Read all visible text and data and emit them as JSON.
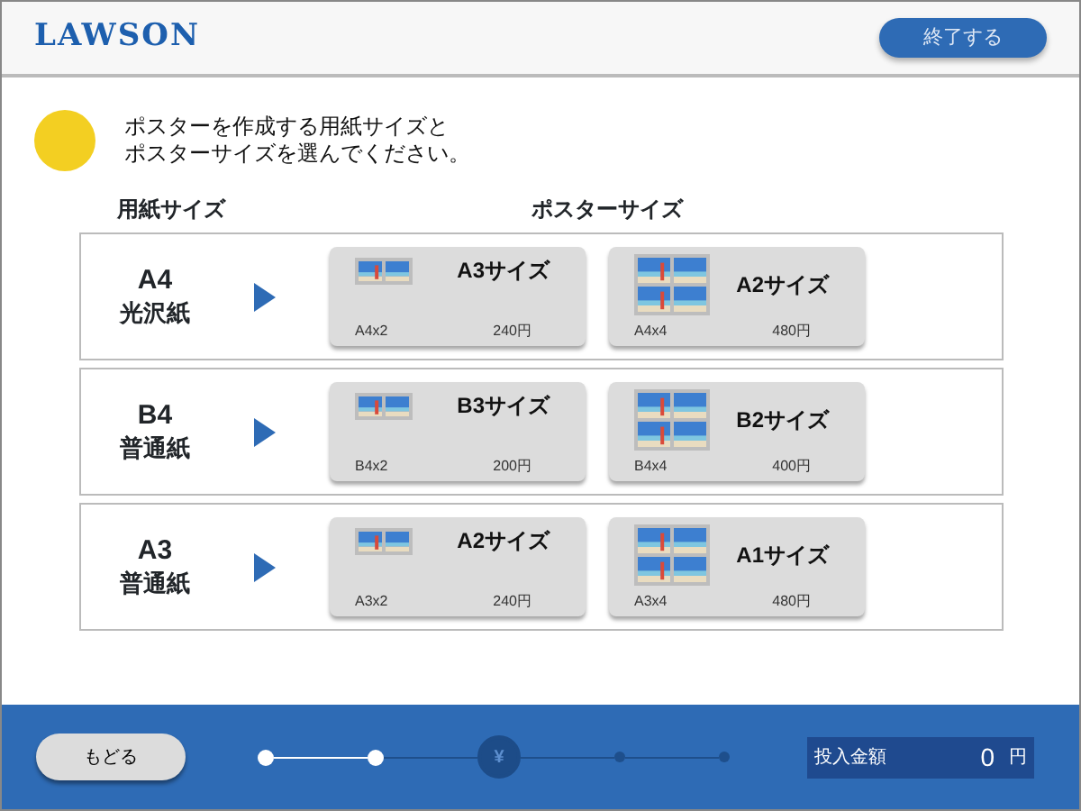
{
  "header": {
    "logo": "LAWSON",
    "exit_button": "終了する"
  },
  "instruction": {
    "lines": [
      "ポスターを作成する用紙サイズと",
      "ポスターサイズを選んでください。"
    ]
  },
  "columns": {
    "paper_size": "用紙サイズ",
    "poster_size": "ポスターサイズ"
  },
  "rows": [
    {
      "size": "A4",
      "paper": "光沢紙",
      "options": [
        {
          "title": "A3サイズ",
          "layout": "A4x2",
          "price": "240円",
          "kind": "two_panel"
        },
        {
          "title": "A2サイズ",
          "layout": "A4x4",
          "price": "480円",
          "kind": "four_panel"
        }
      ]
    },
    {
      "size": "B4",
      "paper": "普通紙",
      "options": [
        {
          "title": "B3サイズ",
          "layout": "B4x2",
          "price": "200円",
          "kind": "two_panel"
        },
        {
          "title": "B2サイズ",
          "layout": "B4x4",
          "price": "400円",
          "kind": "four_panel"
        }
      ]
    },
    {
      "size": "A3",
      "paper": "普通紙",
      "options": [
        {
          "title": "A2サイズ",
          "layout": "A3x2",
          "price": "240円",
          "kind": "two_panel"
        },
        {
          "title": "A1サイズ",
          "layout": "A3x4",
          "price": "480円",
          "kind": "four_panel"
        }
      ]
    }
  ],
  "footer": {
    "back_button": "もどる",
    "steps": [
      {
        "done": true,
        "current": false
      },
      {
        "done": true,
        "current": false
      },
      {
        "done": false,
        "current": true,
        "symbol": "¥"
      },
      {
        "done": false,
        "current": false
      },
      {
        "done": false,
        "current": false
      }
    ],
    "amount_label": "投入金額",
    "amount": "0",
    "currency": "円"
  }
}
